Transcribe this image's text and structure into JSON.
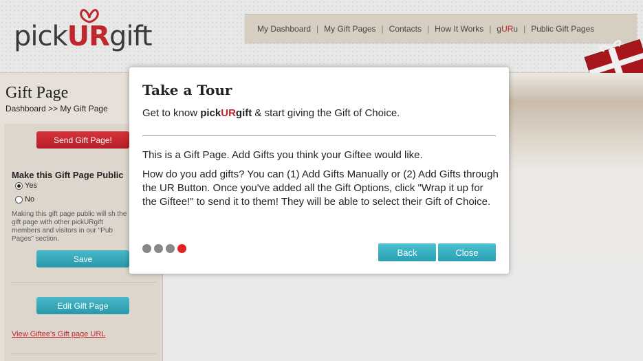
{
  "header": {
    "logo": {
      "pre": "pick",
      "ur": "UR",
      "post": "gift"
    },
    "nav": [
      {
        "label": "My Dashboard"
      },
      {
        "label": "My Gift Pages"
      },
      {
        "label": "Contacts"
      },
      {
        "label": "How It Works"
      },
      {
        "label_pre": "g",
        "label_ur": "UR",
        "label_post": "u"
      },
      {
        "label": "Public Gift Pages"
      }
    ],
    "nav_separator": "|"
  },
  "page": {
    "title": "Gift Page",
    "breadcrumb": "Dashboard >> My Gift Page"
  },
  "sidebar": {
    "send_button": "Send Gift Page!",
    "public_title": "Make this Gift Page Public",
    "radio_yes": "Yes",
    "radio_no": "No",
    "radio_selected": "Yes",
    "public_desc": "Making this gift page public will sh the gift page with other pickURgift members and visitors in our \"Pub Pages\" section.",
    "save_button": "Save",
    "edit_button": "Edit Gift Page",
    "view_url_link": "View Giftee's Gift page URL"
  },
  "tour_modal": {
    "title": "Take a Tour",
    "subtitle_pre": "Get to know ",
    "subtitle_brand_pre": "pick",
    "subtitle_brand_ur": "UR",
    "subtitle_brand_post": "gift",
    "subtitle_post": " & start giving the Gift of Choice.",
    "paragraph1": "This is a Gift Page. Add Gifts you think your Giftee would like.",
    "paragraph2": "How do you add gifts? You can (1) Add Gifts Manually or (2) Add Gifts through the UR Button. Once you've added all the Gift Options, click \"Wrap it up for the Giftee!\" to send it to them! They will be able to select their Gift of Choice.",
    "steps_total": 4,
    "step_current": 4,
    "back_button": "Back",
    "close_button": "Close"
  },
  "colors": {
    "brand_red": "#c0262d",
    "teal_button": "#2aa0b4",
    "active_dot": "#e32224",
    "inactive_dot": "#888888"
  }
}
